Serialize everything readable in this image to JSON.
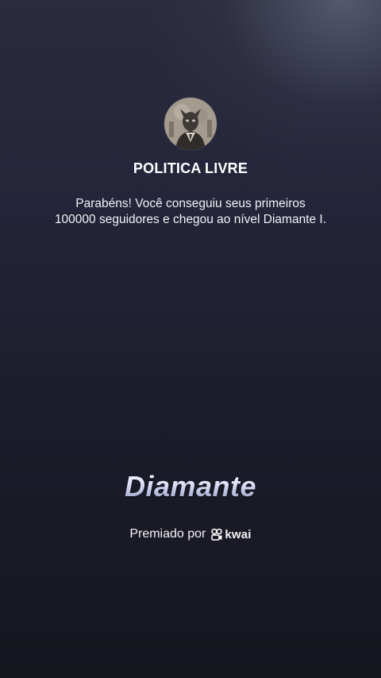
{
  "profile": {
    "account_name": "POLITICA LIVRE",
    "avatar_icon": "profile-photo-icon"
  },
  "message": {
    "line1": "Parabéns! Você conseguiu seus primeiros",
    "line2": "100000 seguidores e chegou ao nível Diamante I."
  },
  "level": {
    "title": "Diamante"
  },
  "footer": {
    "awarded_by": "Premiado por",
    "brand_name": "kwai",
    "brand_icon": "kwai-logo-icon"
  },
  "colors": {
    "background_top": "#2a2b3d",
    "background_bottom": "#16161f",
    "level_title_light": "#ffffff",
    "level_title_dark": "#8f96c0",
    "text": "#ffffff"
  }
}
